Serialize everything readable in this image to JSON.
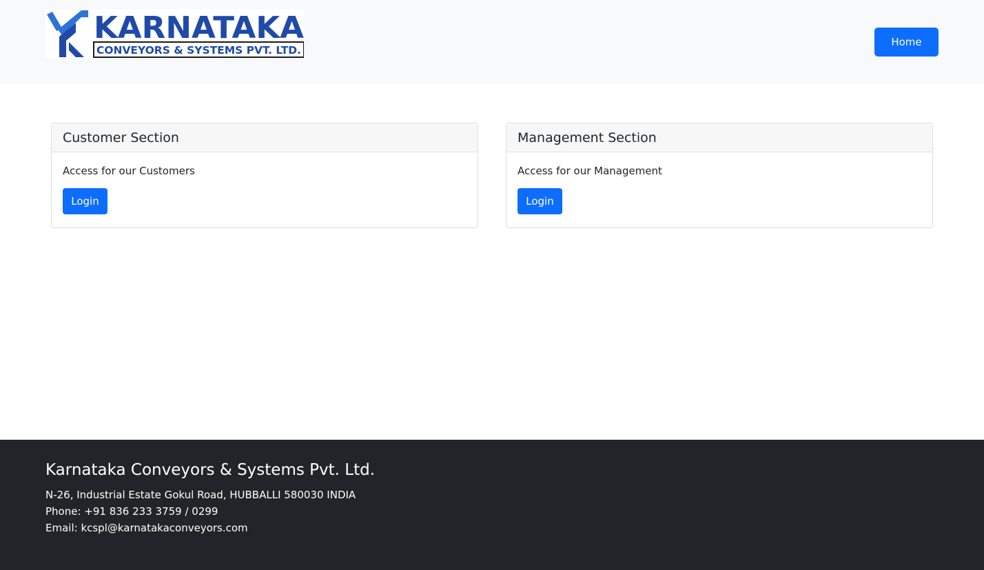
{
  "header": {
    "logo": {
      "title": "KARNATAKA",
      "subtitle": "CONVEYORS & SYSTEMS PVT. LTD.",
      "colors": {
        "text": "#1f4aa8",
        "accent": "#2e74d6",
        "border": "#1a1a1a"
      }
    },
    "home_label": "Home"
  },
  "sections": {
    "customer": {
      "title": "Customer Section",
      "description": "Access for our Customers",
      "login_label": "Login"
    },
    "management": {
      "title": "Management Section",
      "description": "Access for our Management",
      "login_label": "Login"
    }
  },
  "footer": {
    "company": "Karnataka Conveyors & Systems Pvt. Ltd.",
    "address": "N-26, Industrial Estate Gokul Road, HUBBALLI 580030 INDIA",
    "phone": "Phone: +91 836 233 3759 / 0299",
    "email": "Email: kcspl@karnatakaconveyors.com"
  },
  "colors": {
    "primary": "#0d6efd",
    "navbar_bg": "#f8f9fa",
    "footer_bg": "#212529"
  }
}
